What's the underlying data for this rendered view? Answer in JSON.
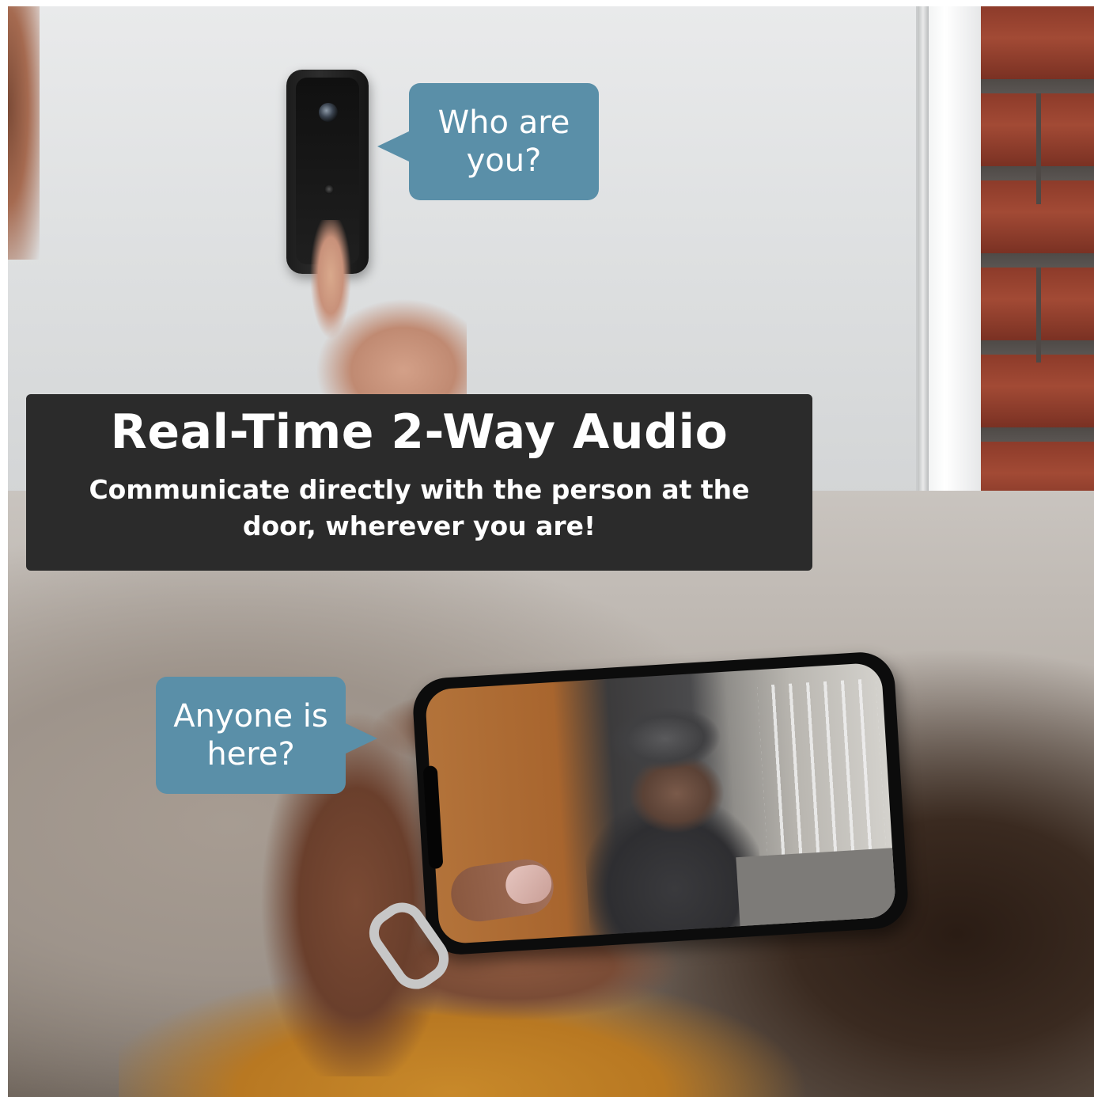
{
  "headline": {
    "title": "Real-Time 2-Way Audio",
    "subtitle": "Communicate directly with the person at the door, wherever you are!"
  },
  "bubbles": {
    "top": "Who are you?",
    "bottom": "Anyone is here?"
  },
  "colors": {
    "bubble": "#5a8fa8",
    "panel": "#2b2b2b",
    "text": "#ffffff"
  }
}
